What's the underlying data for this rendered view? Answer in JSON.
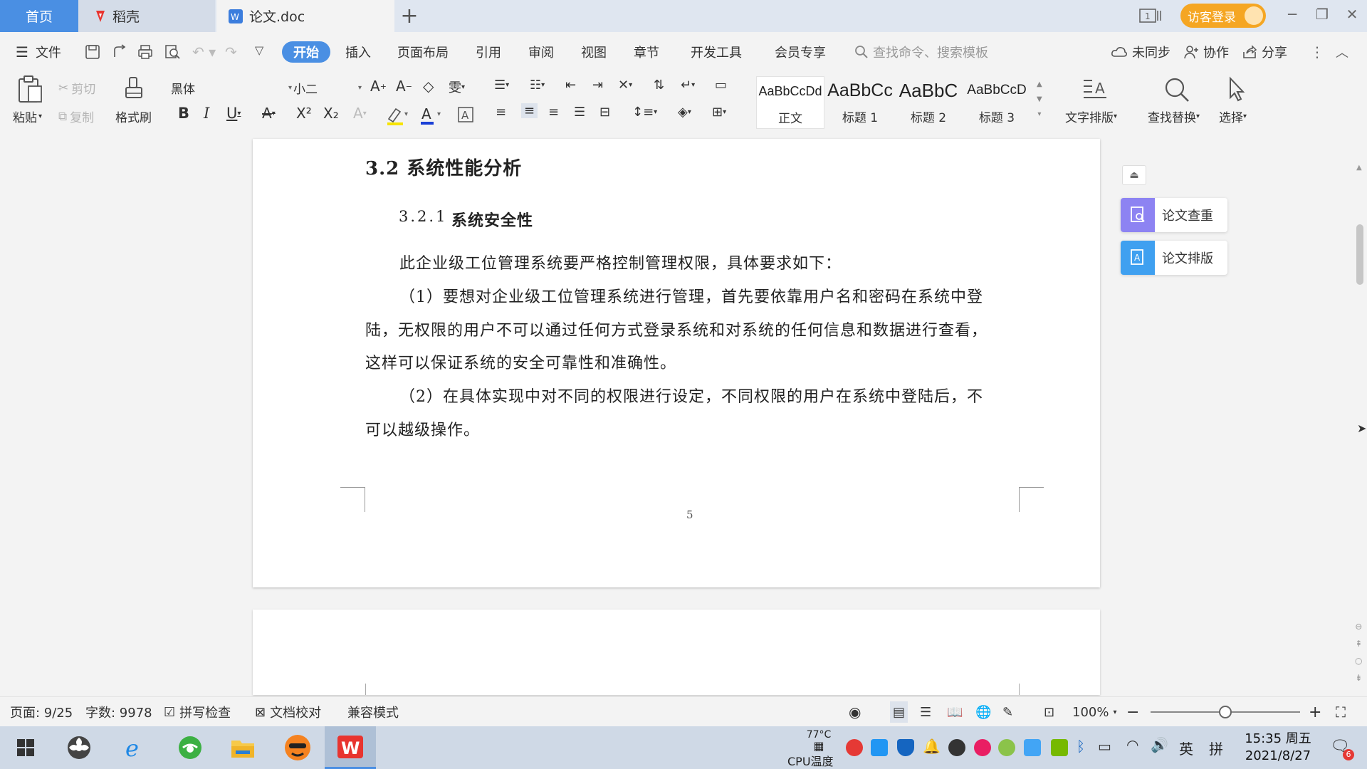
{
  "titlebar": {
    "tabs": [
      {
        "label": "首页"
      },
      {
        "label": "稻壳"
      },
      {
        "label": "论文.doc"
      }
    ],
    "login_label": "访客登录"
  },
  "menubar": {
    "file_label": "文件",
    "items": [
      "开始",
      "插入",
      "页面布局",
      "引用",
      "审阅",
      "视图",
      "章节",
      "开发工具",
      "会员专享"
    ],
    "search_placeholder": "查找命令、搜索模板",
    "sync_label": "未同步",
    "collab_label": "协作",
    "share_label": "分享"
  },
  "ribbon": {
    "paste_label": "粘贴",
    "cut_label": "剪切",
    "copy_label": "复制",
    "format_painter_label": "格式刷",
    "font_name": "黑体",
    "font_size": "小二",
    "styles": [
      {
        "preview": "AaBbCcDd",
        "name": "正文"
      },
      {
        "preview": "AaBbCc",
        "name": "标题 1"
      },
      {
        "preview": "AaBbC",
        "name": "标题 2"
      },
      {
        "preview": "AaBbCcD",
        "name": "标题 3"
      }
    ],
    "text_layout_label": "文字排版",
    "find_replace_label": "查找替换",
    "select_label": "选择"
  },
  "document": {
    "heading2": "3.2 系统性能分析",
    "heading3_num": "3.2.1",
    "heading3_text": "系统安全性",
    "para1": "此企业级工位管理系统要严格控制管理权限，具体要求如下：",
    "para2_lines": [
      "（1）要想对企业级工位管理系统进行管理，首先要依靠用户名和密码在系统中登",
      "陆，无权限的用户不可以通过任何方式登录系统和对系统的任何信息和数据进行查看，",
      "这样可以保证系统的安全可靠性和准确性。"
    ],
    "para3_lines": [
      "（2）在具体实现中对不同的权限进行设定，不同权限的用户在系统中登陆后，不",
      "可以越级操作。"
    ],
    "page_number": "5"
  },
  "side_panel": {
    "check_label": "论文查重",
    "layout_label": "论文排版"
  },
  "statusbar": {
    "page_info": "页面: 9/25",
    "word_count": "字数: 9978",
    "spell_check": "拼写检查",
    "doc_proof": "文档校对",
    "compat_mode": "兼容模式",
    "zoom": "100%",
    "zoom_fraction": 0.5
  },
  "taskbar": {
    "cpu_temp": "77°C",
    "cpu_label": "CPU温度",
    "ime_lang": "英",
    "ime_mode": "拼",
    "time": "15:35 周五",
    "date": "2021/8/27",
    "notification_count": "6"
  },
  "colors": {
    "accent": "#4a8fe3",
    "login": "#f5a623",
    "wps_red": "#e8342f"
  }
}
